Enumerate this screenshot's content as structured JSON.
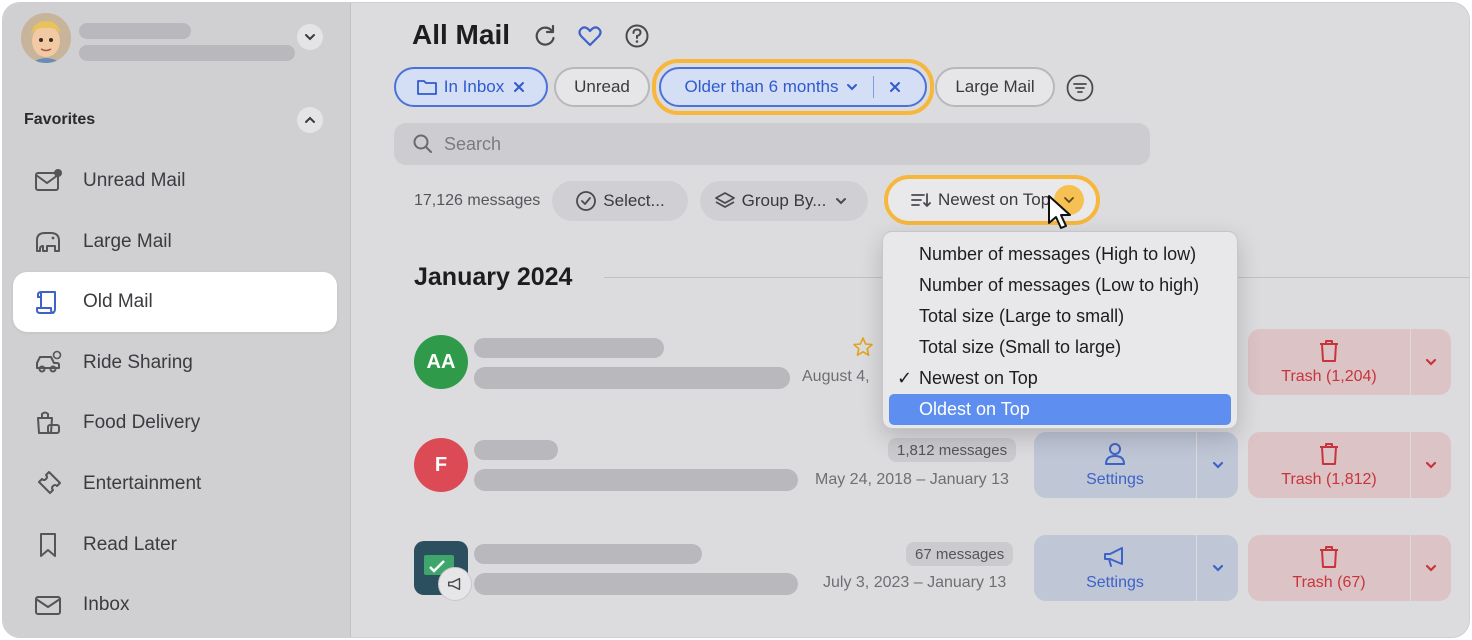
{
  "sidebar": {
    "favorites_title": "Favorites",
    "items": [
      {
        "label": "Unread Mail",
        "icon": "unread-mail-icon"
      },
      {
        "label": "Large Mail",
        "icon": "elephant-icon"
      },
      {
        "label": "Old Mail",
        "icon": "scroll-icon",
        "active": true
      },
      {
        "label": "Ride Sharing",
        "icon": "car-icon"
      },
      {
        "label": "Food Delivery",
        "icon": "food-bag-icon"
      },
      {
        "label": "Entertainment",
        "icon": "ticket-icon"
      },
      {
        "label": "Read Later",
        "icon": "bookmark-icon"
      },
      {
        "label": "Inbox",
        "icon": "inbox-icon"
      }
    ]
  },
  "header": {
    "title": "All Mail",
    "filters": {
      "in_inbox": "In Inbox",
      "unread": "Unread",
      "older_than": "Older than 6 months",
      "large_mail": "Large Mail"
    },
    "search_placeholder": "Search"
  },
  "toolbar": {
    "message_count": "17,126 messages",
    "select_label": "Select...",
    "group_by_label": "Group By...",
    "sort_label": "Newest on Top"
  },
  "sort_menu": {
    "options": [
      "Number of messages (High to low)",
      "Number of messages (Low to high)",
      "Total size (Large to small)",
      "Total size (Small to large)",
      "Newest on Top",
      "Oldest on Top"
    ],
    "selected": "Newest on Top",
    "hovered": "Oldest on Top"
  },
  "section_title": "January 2024",
  "rows": [
    {
      "initials": "AA",
      "avatar_color": "#2f9a4a",
      "date": "August 4,",
      "starred": true,
      "trash_label": "Trash (1,204)"
    },
    {
      "initials": "F",
      "avatar_color": "#dc4a55",
      "badge": "1,812 messages",
      "date": "May 24, 2018 – January 13",
      "settings_label": "Settings",
      "trash_label": "Trash (1,812)"
    },
    {
      "initials": "",
      "avatar_color": "#2b4f5f",
      "badge": "67 messages",
      "date": "July 3, 2023 – January 13",
      "settings_label": "Settings",
      "trash_label": "Trash (67)"
    }
  ],
  "colors": {
    "accent_blue": "#4b72d9",
    "highlight_ring": "#f6b73c",
    "trash_red": "#c9343b"
  }
}
